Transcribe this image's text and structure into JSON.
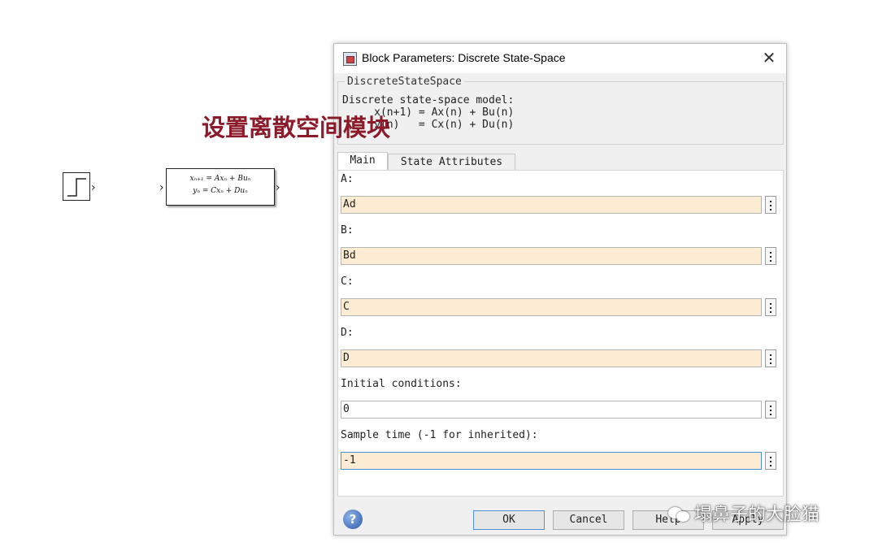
{
  "overlay": {
    "title": "设置离散空间模块"
  },
  "canvas": {
    "state_space_block": {
      "eq1": "xₙ₊₁ = Axₙ + Buₙ",
      "eq2": "yₙ = Cxₙ + Duₙ"
    }
  },
  "dialog": {
    "title": "Block Parameters: Discrete State-Space",
    "group_title": "DiscreteStateSpace",
    "description": "Discrete state-space model:\n     x(n+1) = Ax(n) + Bu(n)\n     y(n)   = Cx(n) + Du(n)",
    "tabs": [
      {
        "label": "Main"
      },
      {
        "label": "State Attributes"
      }
    ],
    "params": [
      {
        "label": "A:",
        "value": "Ad"
      },
      {
        "label": "B:",
        "value": "Bd"
      },
      {
        "label": "C:",
        "value": "C"
      },
      {
        "label": "D:",
        "value": "D"
      },
      {
        "label": "Initial conditions:",
        "value": "0"
      },
      {
        "label": "Sample time (-1 for inherited):",
        "value": "-1"
      }
    ],
    "buttons": {
      "ok": "OK",
      "cancel": "Cancel",
      "help": "Help",
      "apply": "Apply"
    }
  },
  "watermark": {
    "text": "塌鼻子的大脸猫"
  },
  "colors": {
    "field_tan": "#fdecd4",
    "overlay_red": "#8b1a2a",
    "focus_blue": "#4a90d9"
  }
}
